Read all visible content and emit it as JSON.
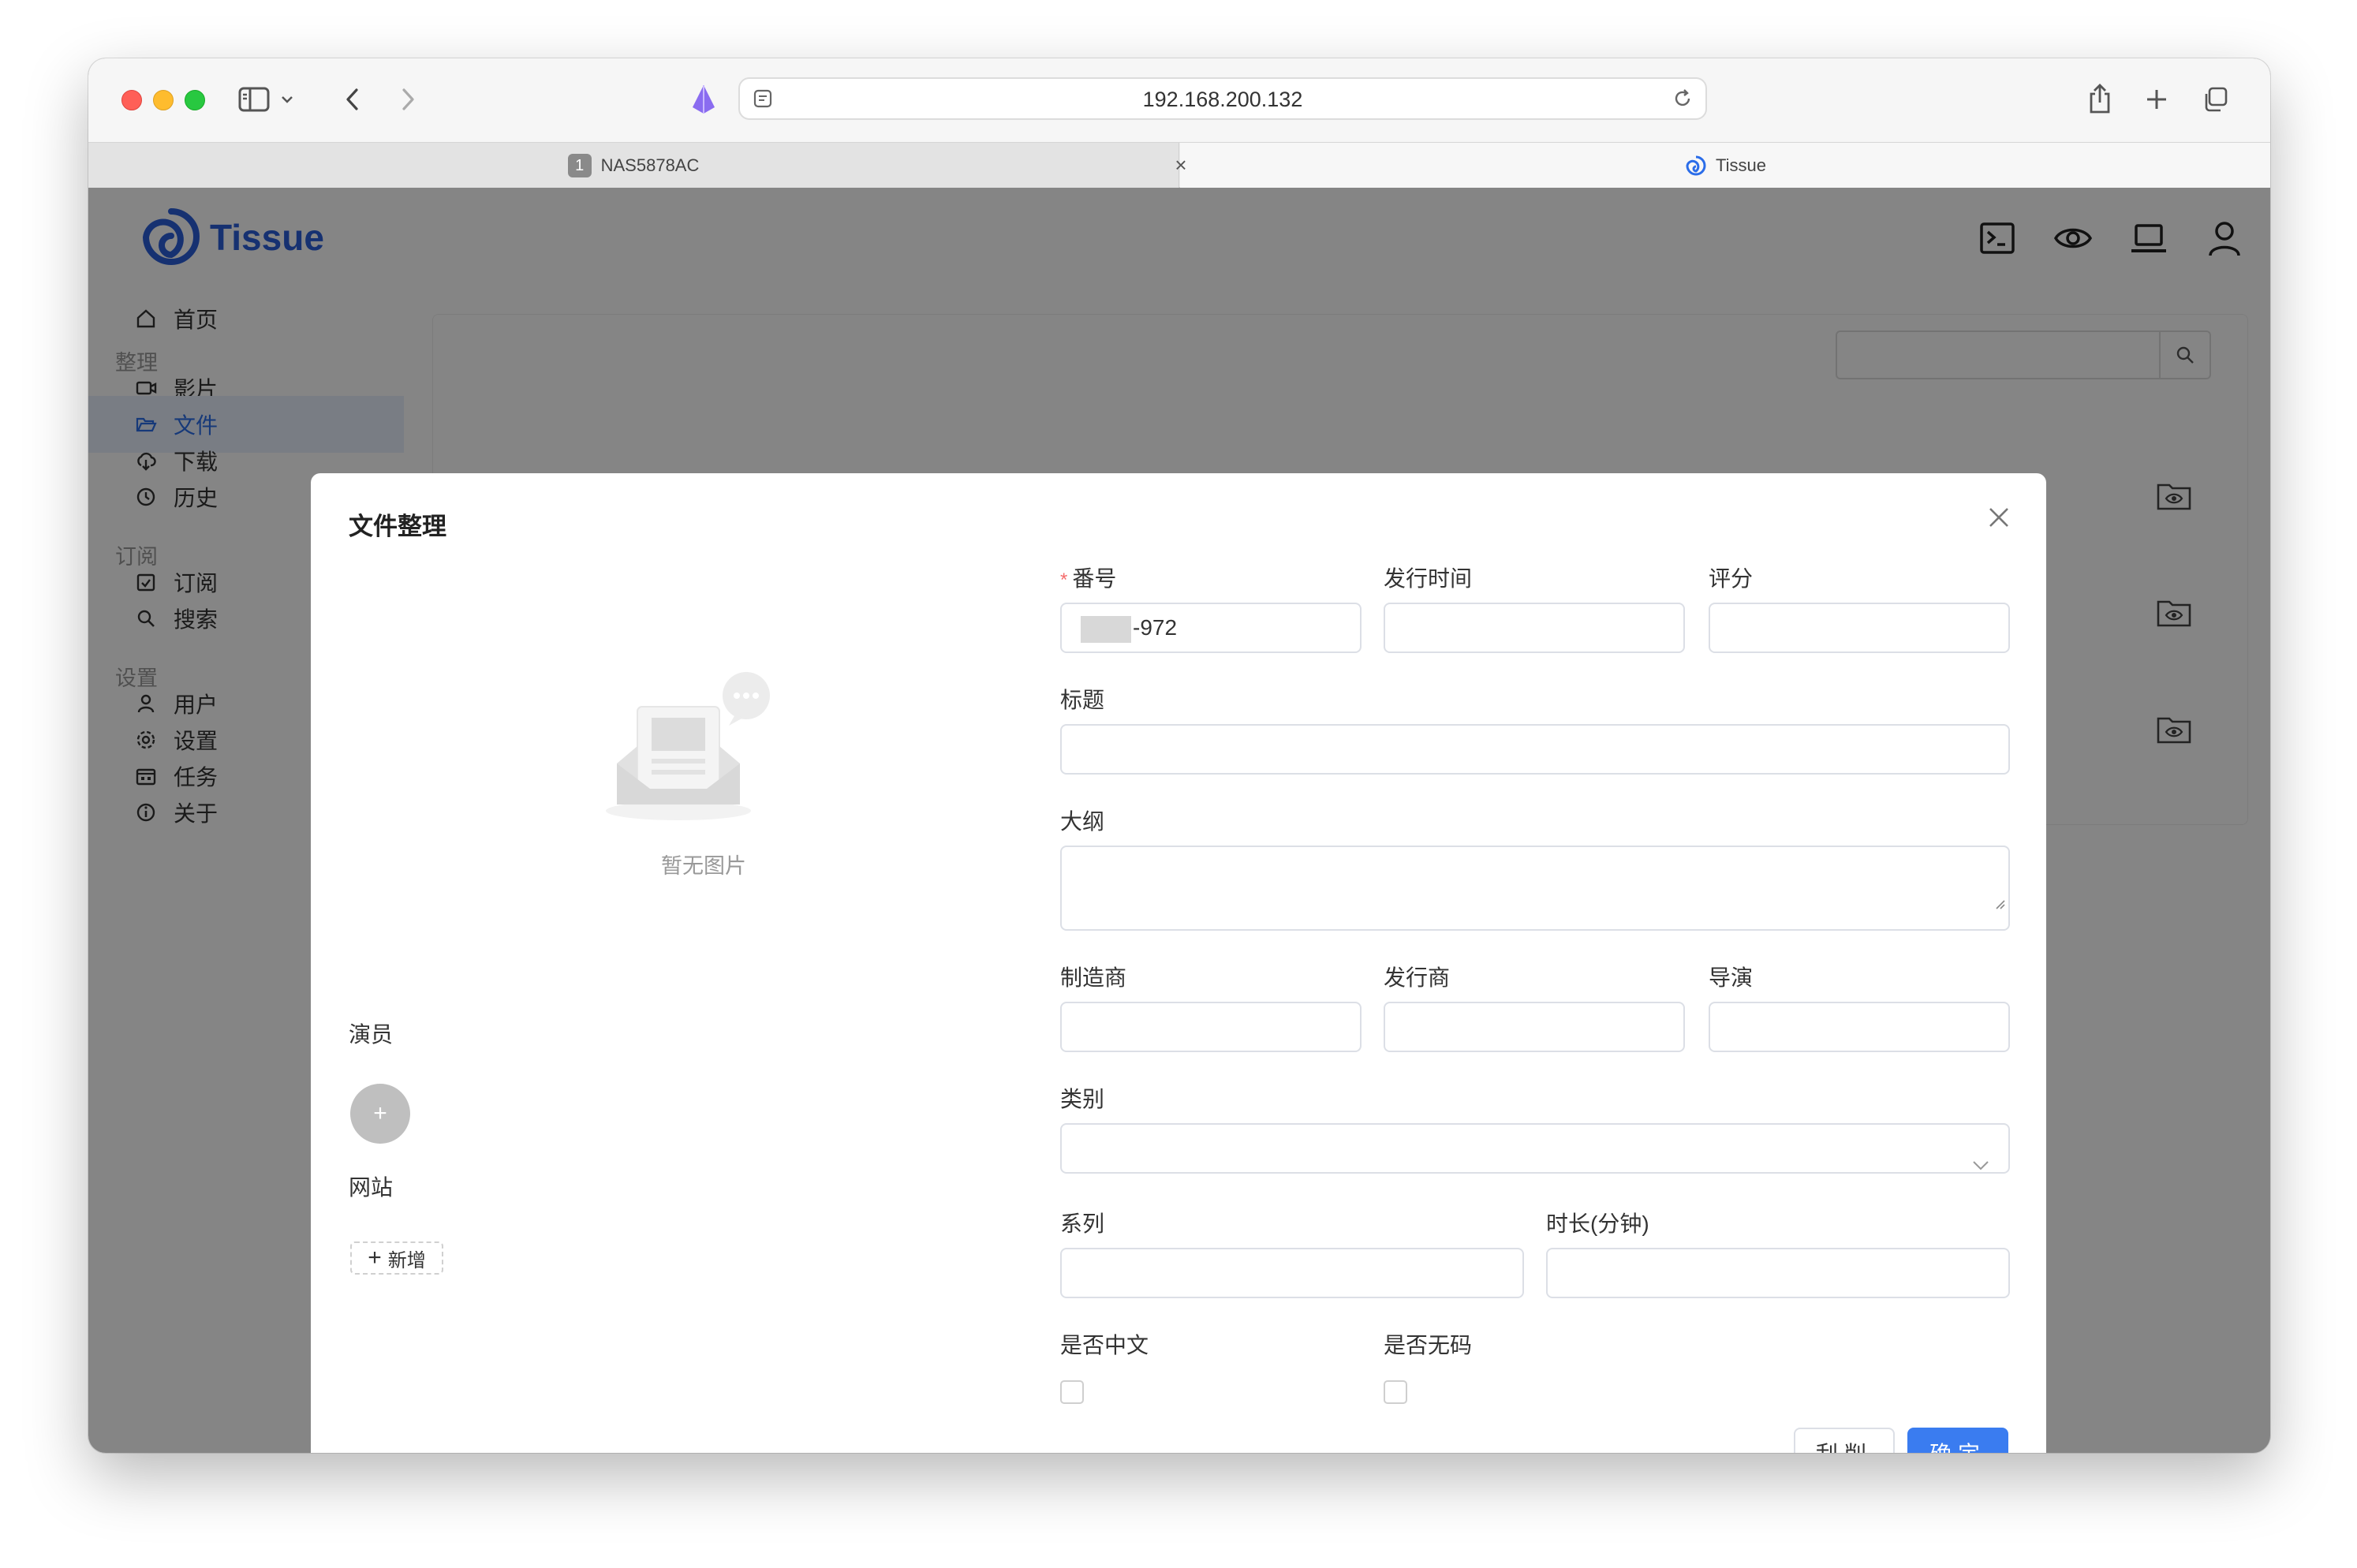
{
  "browser": {
    "url": "192.168.200.132",
    "tabs": [
      {
        "badge": "1",
        "title": "NAS5878AC"
      },
      {
        "title": "Tissue"
      }
    ],
    "tab_close": "×"
  },
  "app": {
    "logo_text": "Tissue",
    "header_icons": [
      "terminal-icon",
      "eye-icon",
      "laptop-icon",
      "user-icon"
    ]
  },
  "sidebar": {
    "home": "首页",
    "section_organize": "整理",
    "movies": "影片",
    "files": "文件",
    "download": "下载",
    "history": "历史",
    "section_subscribe": "订阅",
    "subscribe": "订阅",
    "search": "搜索",
    "section_settings": "设置",
    "users": "用户",
    "settings": "设置",
    "tasks": "任务",
    "about": "关于"
  },
  "dialog": {
    "title": "文件整理",
    "empty_image_text": "暂无图片",
    "actors_label": "演员",
    "add_actor": "+",
    "sites_label": "网站",
    "add_site_plus": "+",
    "add_site_label": "新增",
    "fields": {
      "code_label": "番号",
      "code_required": "*",
      "code_value": "-972",
      "release_date_label": "发行时间",
      "rating_label": "评分",
      "title_label": "标题",
      "outline_label": "大纲",
      "studio_label": "制造商",
      "publisher_label": "发行商",
      "director_label": "导演",
      "genre_label": "类别",
      "series_label": "系列",
      "runtime_label": "时长(分钟)",
      "chinese_sub_label": "是否中文",
      "uncensored_label": "是否无码"
    },
    "buttons": {
      "scrape": "刮削",
      "confirm": "确定"
    }
  },
  "colors": {
    "primary": "#3a7cf0",
    "logo": "#2b5fd9",
    "required": "#f56c6c"
  }
}
